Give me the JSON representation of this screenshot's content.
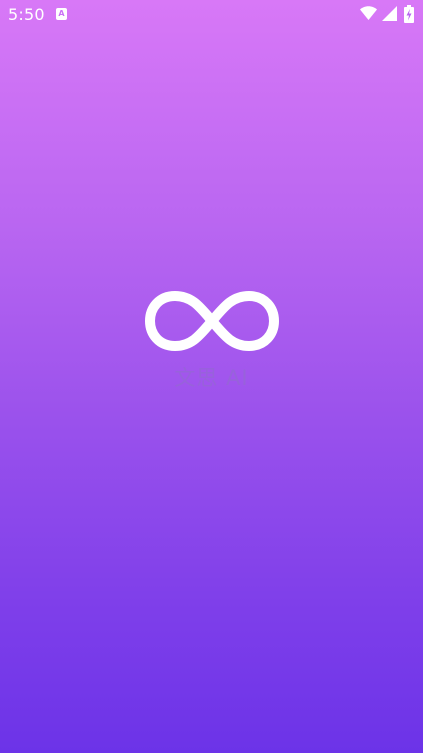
{
  "status_bar": {
    "time": "5:50",
    "app_icon_letter": "A",
    "icons": [
      "app-notification-icon",
      "wifi-icon",
      "signal-icon",
      "battery-charging-icon"
    ]
  },
  "splash": {
    "logo_icon": "infinity-icon",
    "brand_name": "文思 AI"
  },
  "colors": {
    "gradient_top": "#d878f7",
    "gradient_bottom": "#6c33e8",
    "logo": "#ffffff",
    "brand_text": "#9664d7"
  }
}
